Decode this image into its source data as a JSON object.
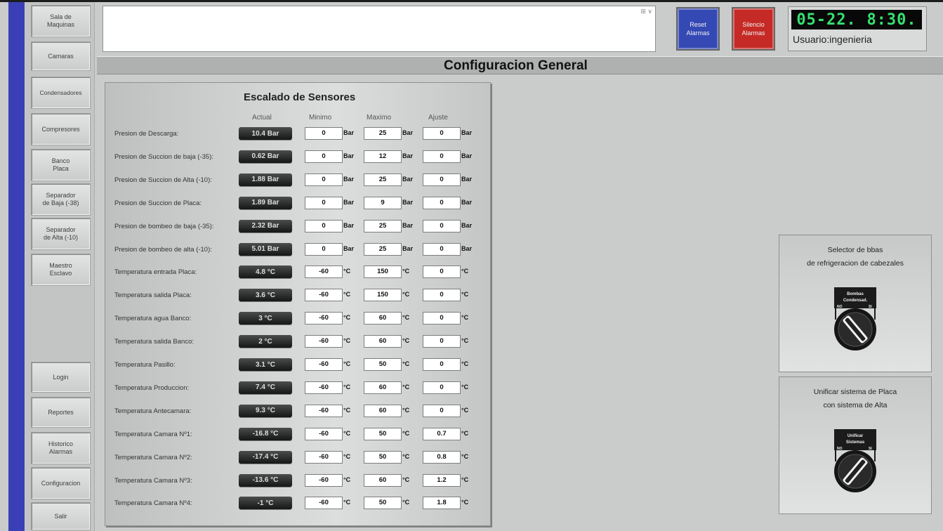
{
  "nav": {
    "sala_maquinas": "Sala de\nMaquinas",
    "camaras": "Camaras",
    "condensadores": "Condensadores",
    "compresores": "Compresores",
    "banco_placa": "Banco\nPlaca",
    "separador_baja": "Separador\nde Baja (-38)",
    "separador_alta": "Separador\nde Alta (-10)",
    "maestro_esclavo": "Maestro\nEsclavo",
    "login": "Login",
    "reportes": "Reportes",
    "historico_alarmas": "Historico\nAlarmas",
    "configuracion": "Configuracion",
    "salir": "Salir"
  },
  "alarm_box": {
    "controls": "⊞ ∨"
  },
  "header": {
    "reset_label": "Reset\nAlarmas",
    "silencio_label": "Silencio\nAlarmas",
    "clock_date": "05-22.",
    "clock_time": "8:30.",
    "user": "Usuario:ingenieria"
  },
  "title": "Configuracion General",
  "panel": {
    "title": "Escalado de Sensores",
    "columns": {
      "actual": "Actual",
      "minimo": "Minimo",
      "maximo": "Maximo",
      "ajuste": "Ajuste"
    },
    "rows": [
      {
        "label": "Presion de Descarga:",
        "actual": "10.4 Bar",
        "min": "0",
        "max": "25",
        "ajuste": "0",
        "unit": "Bar"
      },
      {
        "label": "Presion de Succion de baja (-35):",
        "actual": "0.62 Bar",
        "min": "0",
        "max": "12",
        "ajuste": "0",
        "unit": "Bar"
      },
      {
        "label": "Presion de Succion de Alta (-10):",
        "actual": "1.88 Bar",
        "min": "0",
        "max": "25",
        "ajuste": "0",
        "unit": "Bar"
      },
      {
        "label": "Presion de Succion de Placa:",
        "actual": "1.89 Bar",
        "min": "0",
        "max": "9",
        "ajuste": "0",
        "unit": "Bar"
      },
      {
        "label": "Presion de bombeo de baja (-35):",
        "actual": "2.32 Bar",
        "min": "0",
        "max": "25",
        "ajuste": "0",
        "unit": "Bar"
      },
      {
        "label": "Presion de bombeo de alta (-10):",
        "actual": "5.01 Bar",
        "min": "0",
        "max": "25",
        "ajuste": "0",
        "unit": "Bar"
      },
      {
        "label": "Temperatura entrada Placa:",
        "actual": "4.8 °C",
        "min": "-60",
        "max": "150",
        "ajuste": "0",
        "unit": "°C"
      },
      {
        "label": "Temperatura salida Placa:",
        "actual": "3.6 °C",
        "min": "-60",
        "max": "150",
        "ajuste": "0",
        "unit": "°C"
      },
      {
        "label": "Temperatura agua Banco:",
        "actual": "3 °C",
        "min": "-60",
        "max": "60",
        "ajuste": "0",
        "unit": "°C"
      },
      {
        "label": "Temperatura salida Banco:",
        "actual": "2 °C",
        "min": "-60",
        "max": "60",
        "ajuste": "0",
        "unit": "°C"
      },
      {
        "label": "Temperatura Pasillo:",
        "actual": "3.1 °C",
        "min": "-60",
        "max": "50",
        "ajuste": "0",
        "unit": "°C"
      },
      {
        "label": "Temperatura Produccion:",
        "actual": "7.4 °C",
        "min": "-60",
        "max": "60",
        "ajuste": "0",
        "unit": "°C"
      },
      {
        "label": "Temperatura Antecamara:",
        "actual": "9.3 °C",
        "min": "-60",
        "max": "60",
        "ajuste": "0",
        "unit": "°C"
      },
      {
        "label": "Temperatura Camara Nº1:",
        "actual": "-16.8 °C",
        "min": "-60",
        "max": "50",
        "ajuste": "0.7",
        "unit": "°C"
      },
      {
        "label": "Temperatura Camara Nº2:",
        "actual": "-17.4 °C",
        "min": "-60",
        "max": "50",
        "ajuste": "0.8",
        "unit": "°C"
      },
      {
        "label": "Temperatura Camara Nº3:",
        "actual": "-13.6 °C",
        "min": "-60",
        "max": "60",
        "ajuste": "1.2",
        "unit": "°C"
      },
      {
        "label": "Temperatura Camara Nº4:",
        "actual": "-1 °C",
        "min": "-60",
        "max": "50",
        "ajuste": "1.8",
        "unit": "°C"
      }
    ]
  },
  "selector_box": {
    "caption": "Selector de bbas\nde refrigeracion de cabezales",
    "switch_label": "Bombas\nCondensad.",
    "left_state": "NO",
    "right_state": "SI"
  },
  "unificar_box": {
    "caption": "Unificar sistema de Placa\ncon sistema de Alta",
    "switch_label": "Unificar\nSistemas",
    "left_state": "NO",
    "right_state": "SI"
  }
}
